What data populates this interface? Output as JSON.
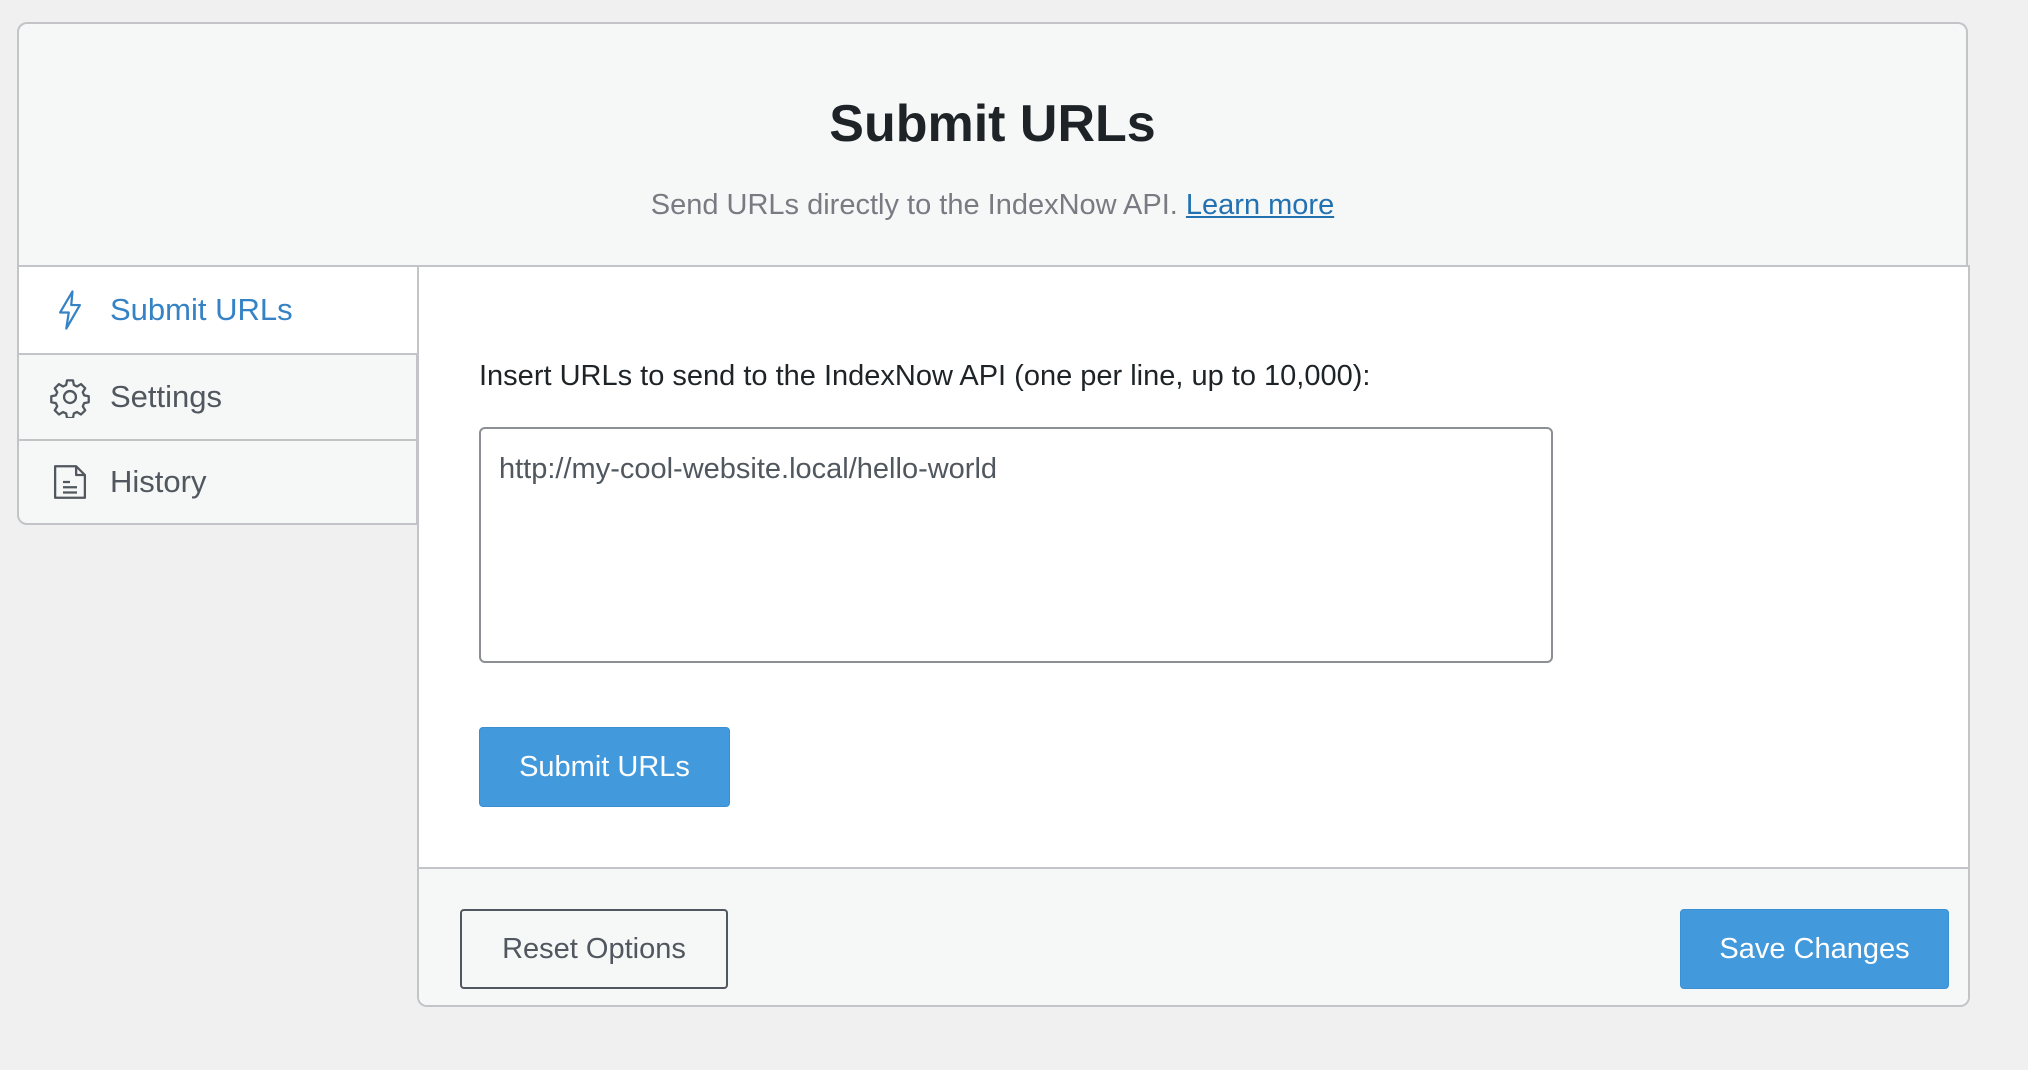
{
  "header": {
    "title": "Submit URLs",
    "subtitle": "Send URLs directly to the IndexNow API.",
    "learn_more": "Learn more"
  },
  "tabs": [
    {
      "label": "Submit URLs",
      "icon": "lightning-icon",
      "active": true
    },
    {
      "label": "Settings",
      "icon": "gear-icon",
      "active": false
    },
    {
      "label": "History",
      "icon": "document-icon",
      "active": false
    }
  ],
  "main": {
    "field_label": "Insert URLs to send to the IndexNow API (one per line, up to 10,000):",
    "textarea_placeholder": "http://my-cool-website.local/hello-world",
    "submit_label": "Submit URLs"
  },
  "footer": {
    "reset_label": "Reset Options",
    "save_label": "Save Changes"
  },
  "colors": {
    "accent": "#4299dc",
    "active_tab_text": "#3582c4",
    "background": "#f0f0f1",
    "border": "#c3c4c7"
  }
}
